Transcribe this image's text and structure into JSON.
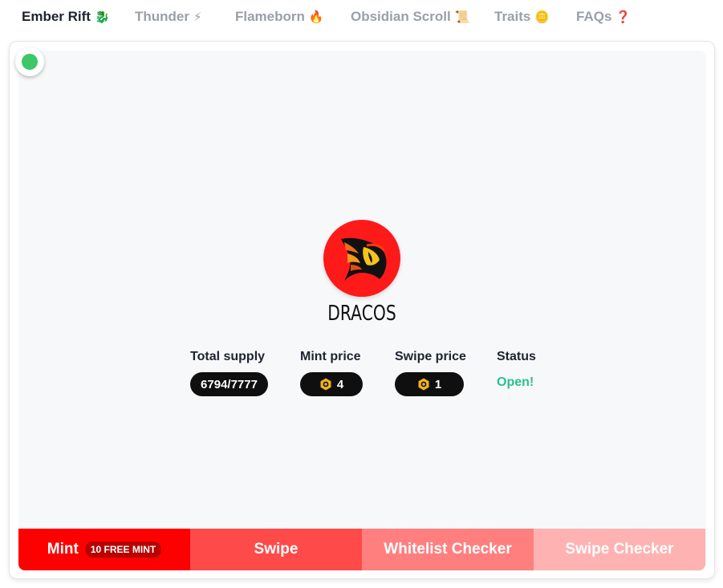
{
  "nav": {
    "items": [
      {
        "label": "Ember Rift",
        "icon": "🐉"
      },
      {
        "label": "Thunder",
        "icon": "⚡"
      },
      {
        "label": "Flameborn",
        "icon": "🔥"
      },
      {
        "label": "Obsidian Scroll",
        "icon": "📜"
      },
      {
        "label": "Traits",
        "icon": "🪙"
      },
      {
        "label": "FAQs",
        "icon": "❓"
      }
    ],
    "active_index": 0
  },
  "status_indicator": {
    "color": "#3ec768"
  },
  "collection": {
    "name": "DRACOS",
    "logo_bg": "#ff1a1a"
  },
  "stats": {
    "total_supply": {
      "label": "Total supply",
      "value": "6794/7777"
    },
    "mint_price": {
      "label": "Mint price",
      "value": "4"
    },
    "swipe_price": {
      "label": "Swipe price",
      "value": "1"
    },
    "status": {
      "label": "Status",
      "value": "Open!",
      "color": "#2ac08b"
    }
  },
  "tabs": {
    "mint": {
      "label": "Mint",
      "badge": "10 FREE MINT"
    },
    "swipe": {
      "label": "Swipe"
    },
    "whitelist_checker": {
      "label": "Whitelist Checker"
    },
    "swipe_checker": {
      "label": "Swipe Checker"
    }
  }
}
